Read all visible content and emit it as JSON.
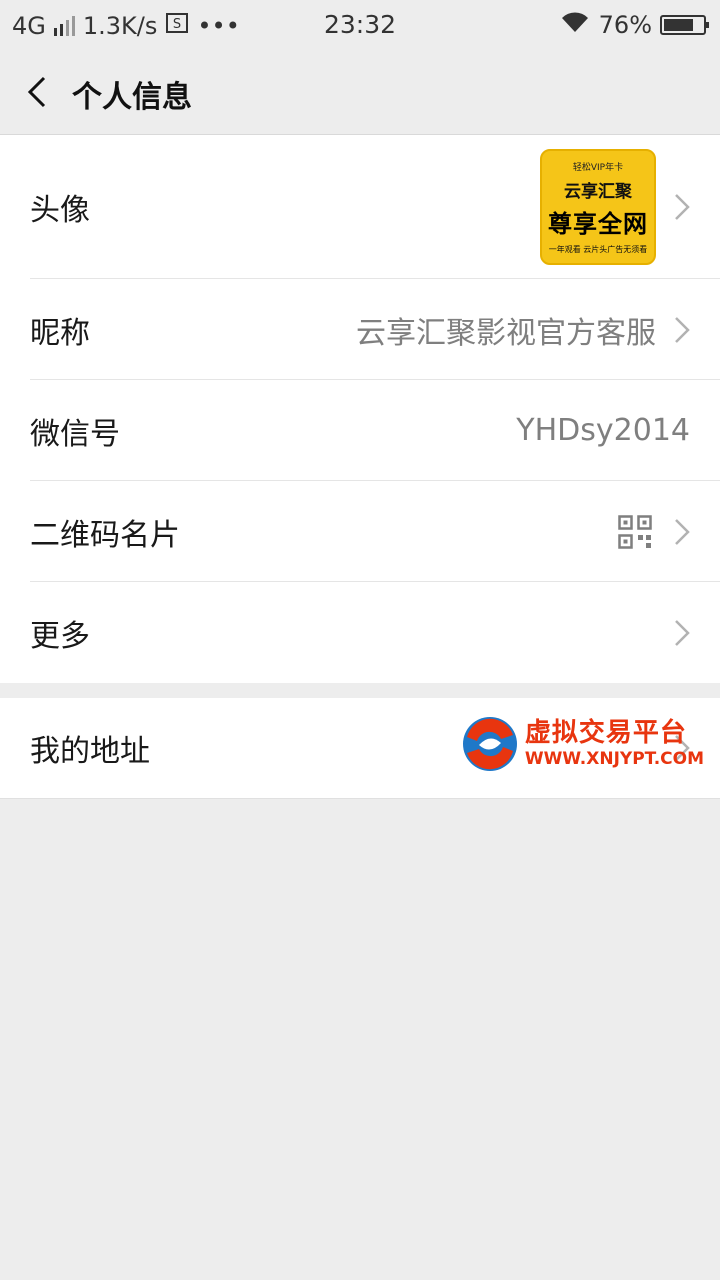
{
  "status_bar": {
    "network": "4G",
    "speed": "1.3K/s",
    "more": "•••",
    "time": "23:32",
    "battery_percent": "76%",
    "battery_level": 0.76
  },
  "nav": {
    "title": "个人信息"
  },
  "rows": {
    "avatar": {
      "label": "头像",
      "image_top": "轻松VIP年卡",
      "image_brand": "云享汇聚",
      "image_main": "尊享全网",
      "image_footer": "一年观看 云片头广告无须看"
    },
    "nickname": {
      "label": "昵称",
      "value": "云享汇聚影视官方客服"
    },
    "wechat_id": {
      "label": "微信号",
      "value": "YHDsy2014"
    },
    "qr_card": {
      "label": "二维码名片",
      "icon": "qr-code-icon"
    },
    "more": {
      "label": "更多"
    },
    "address": {
      "label": "我的地址"
    }
  },
  "watermark": {
    "cn": "虚拟交易平台",
    "url": "WWW.XNJYPT.COM"
  },
  "colors": {
    "background": "#ededed",
    "card": "#ffffff",
    "accent_watermark": "#e8350f"
  }
}
